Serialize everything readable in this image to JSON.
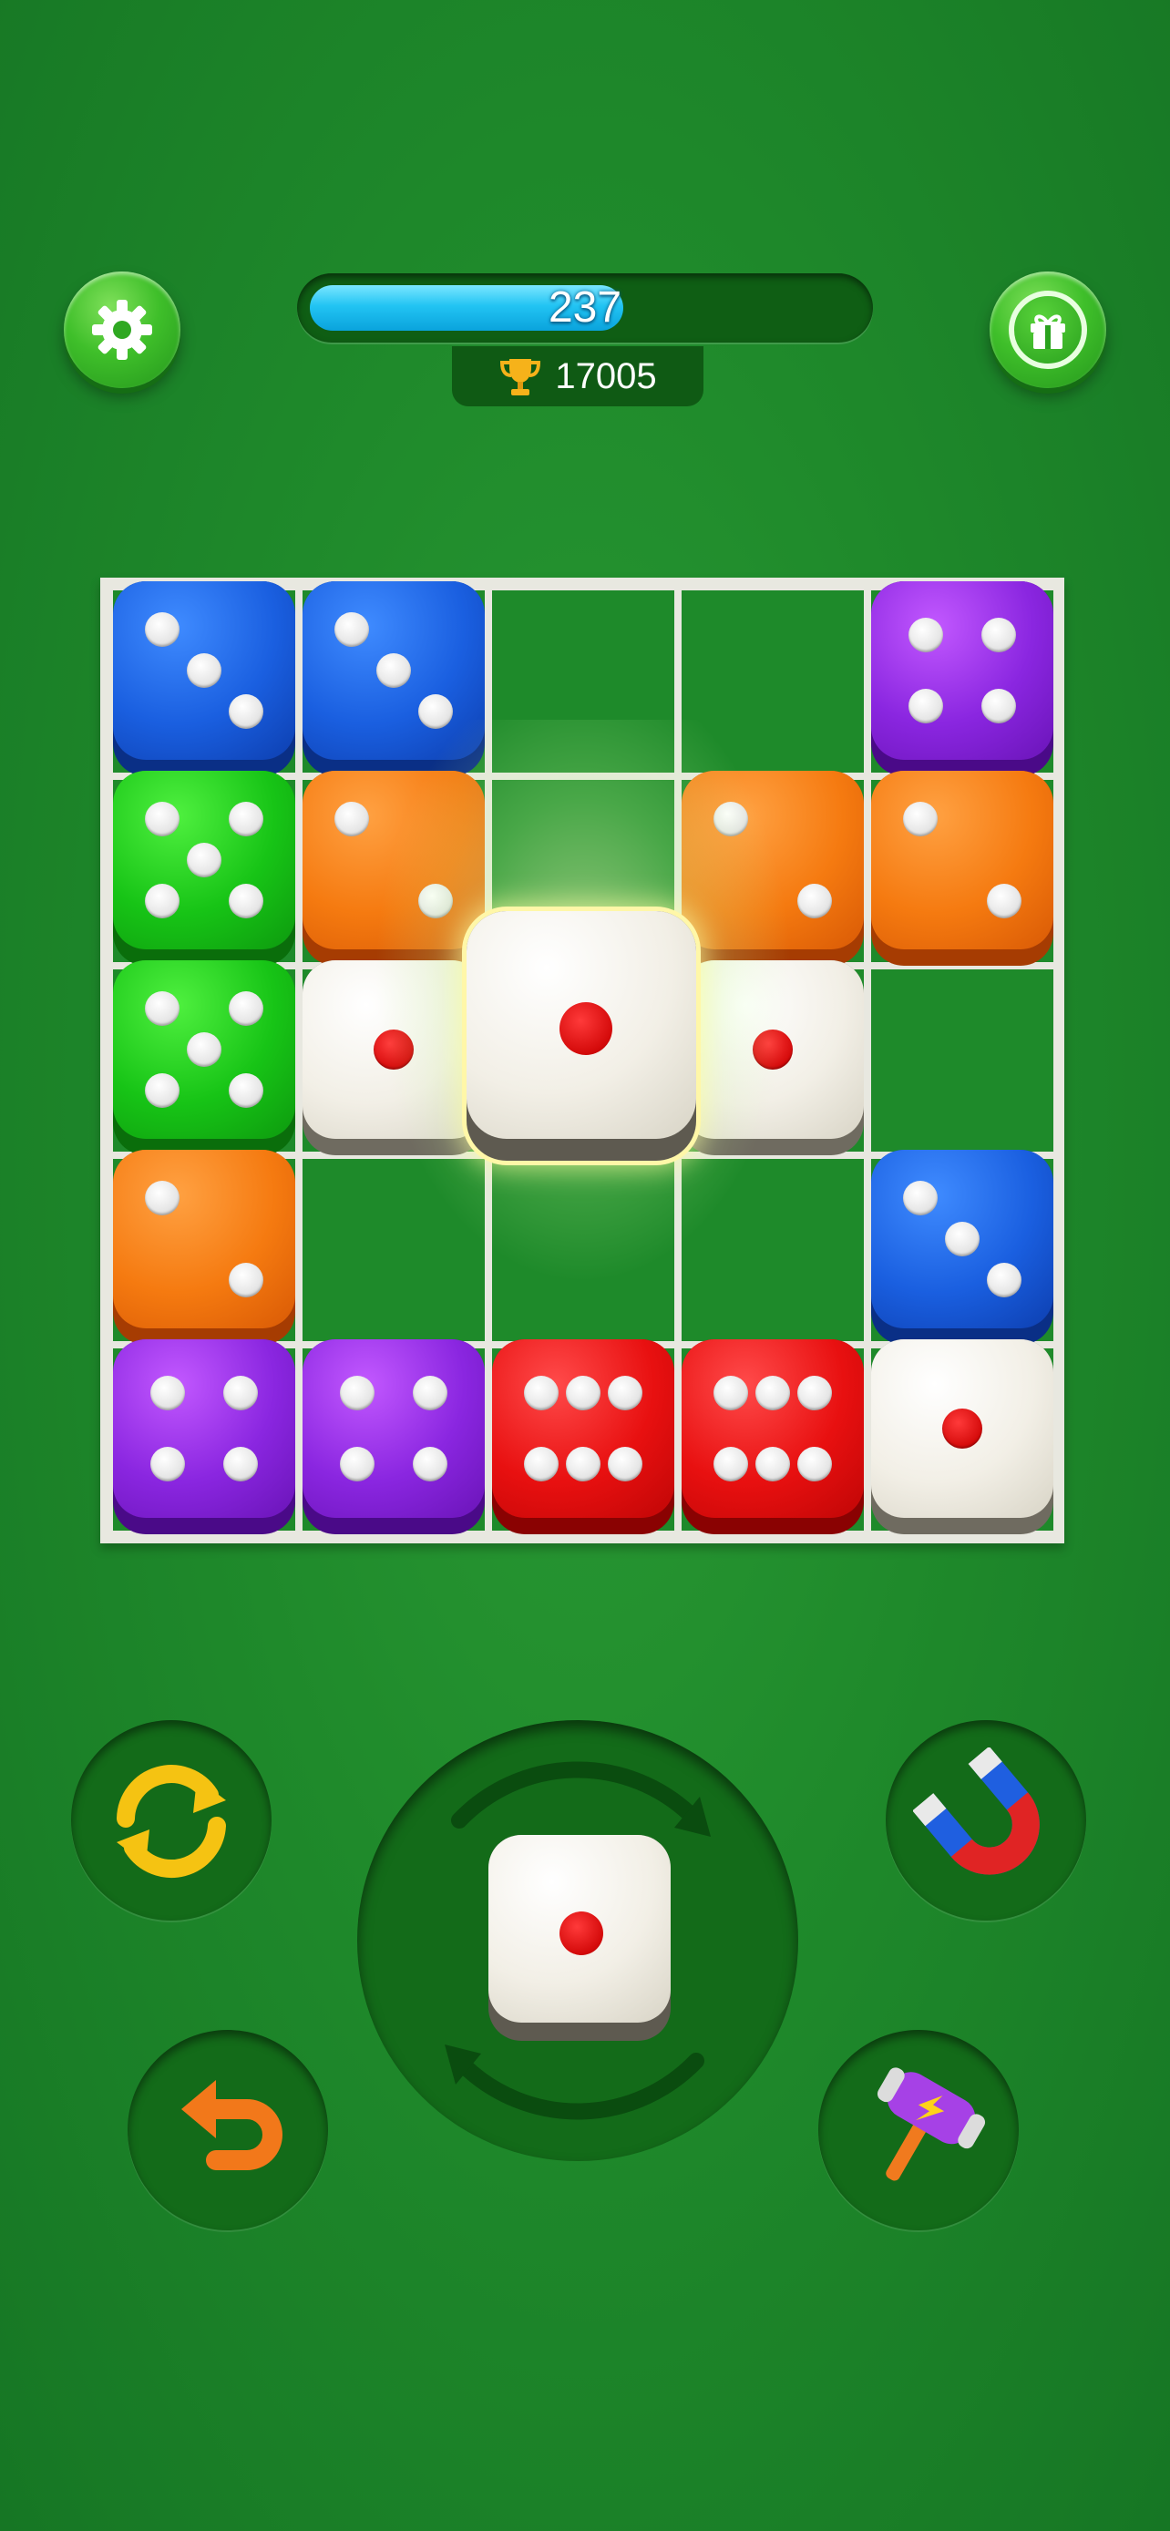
{
  "header": {
    "level_progress_value": "237",
    "level_progress_fraction": 0.57,
    "trophy_score": "17005",
    "settings_icon": "gear-icon",
    "gift_icon": "gift-icon",
    "trophy_icon": "trophy-icon"
  },
  "board": {
    "rows": 5,
    "cols": 5,
    "cells": [
      [
        {
          "color": "blue",
          "pips": 3
        },
        {
          "color": "blue",
          "pips": 3
        },
        null,
        null,
        {
          "color": "purple",
          "pips": 4
        }
      ],
      [
        {
          "color": "green",
          "pips": 5
        },
        {
          "color": "orange",
          "pips": 2
        },
        null,
        {
          "color": "orange",
          "pips": 2
        },
        {
          "color": "orange",
          "pips": 2
        }
      ],
      [
        {
          "color": "green",
          "pips": 5
        },
        {
          "color": "white",
          "pips": 1
        },
        {
          "color": "white",
          "pips": 1,
          "highlighted": true
        },
        {
          "color": "white",
          "pips": 1
        },
        null
      ],
      [
        {
          "color": "orange",
          "pips": 2
        },
        null,
        null,
        null,
        {
          "color": "blue",
          "pips": 3
        }
      ],
      [
        {
          "color": "purple",
          "pips": 4
        },
        {
          "color": "purple",
          "pips": 4
        },
        {
          "color": "red",
          "pips": 6
        },
        {
          "color": "red",
          "pips": 6
        },
        {
          "color": "white",
          "pips": 1
        }
      ]
    ]
  },
  "controls": {
    "next_die": {
      "color": "white",
      "pips": 1
    },
    "refresh_icon": "refresh-icon",
    "undo_icon": "undo-arrow-icon",
    "magnet_icon": "magnet-icon",
    "hammer_icon": "hammer-icon",
    "rotate_icon": "rotate-arrows-icon"
  },
  "colors": {
    "background": "#1f8a2b",
    "progress": "#22c4f3",
    "blue": "#1a5fe0",
    "green": "#17c416",
    "orange": "#f57a10",
    "purple": "#8a26e0",
    "red": "#e81010",
    "white": "#f2efe6"
  }
}
